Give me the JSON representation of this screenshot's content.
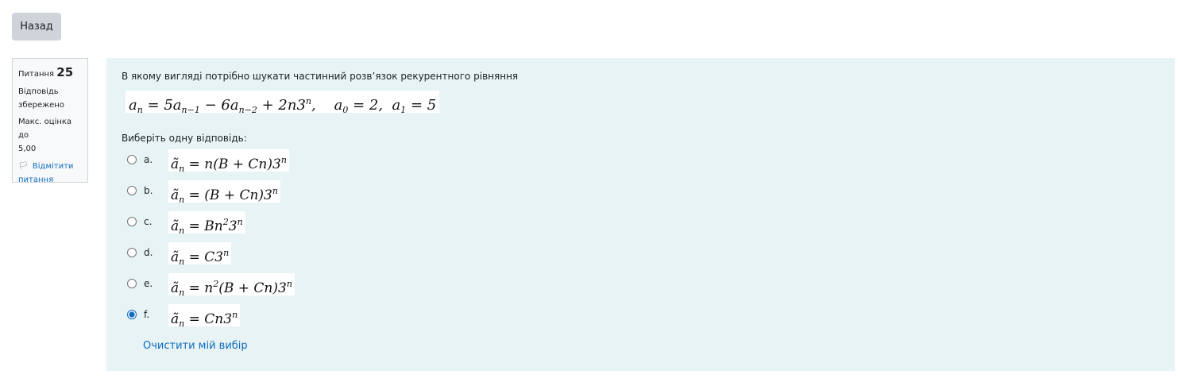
{
  "nav": {
    "back_label": "Назад"
  },
  "info": {
    "question_label": "Питання",
    "question_number": "25",
    "state_line1": "Відповідь",
    "state_line2": "збережено",
    "grade_line1": "Макс. оцінка до",
    "grade_line2": "5,00",
    "flag_line1": "Відмітити",
    "flag_line2": "питання",
    "flag_icon": "flag-outline-icon"
  },
  "question": {
    "text": "В якому вигляді потрібно шукати частинний розв’язок рекурентного рівняння",
    "equation": "a_n = 5a_{n−1} − 6a_{n−2} + 2n3^n,   a_0 = 2,  a_1 = 5",
    "prompt": "Виберіть одну відповідь:"
  },
  "options": [
    {
      "letter": "a.",
      "formula": "ã_n = n(B + Cn)3^n",
      "selected": false
    },
    {
      "letter": "b.",
      "formula": "ã_n = (B + Cn)3^n",
      "selected": false
    },
    {
      "letter": "c.",
      "formula": "ã_n = Bn^2 3^n",
      "selected": false
    },
    {
      "letter": "d.",
      "formula": "ã_n = C3^n",
      "selected": false
    },
    {
      "letter": "e.",
      "formula": "ã_n = n^2(B + Cn)3^n",
      "selected": false
    },
    {
      "letter": "f.",
      "formula": "ã_n = Cn3^n",
      "selected": true
    }
  ],
  "clear_choice_label": "Очистити мій вибір",
  "colors": {
    "accent": "#0f6cbf",
    "content_bg": "#e7f3f5",
    "info_bg": "#f8f9fa",
    "button_bg": "#ced4da"
  }
}
